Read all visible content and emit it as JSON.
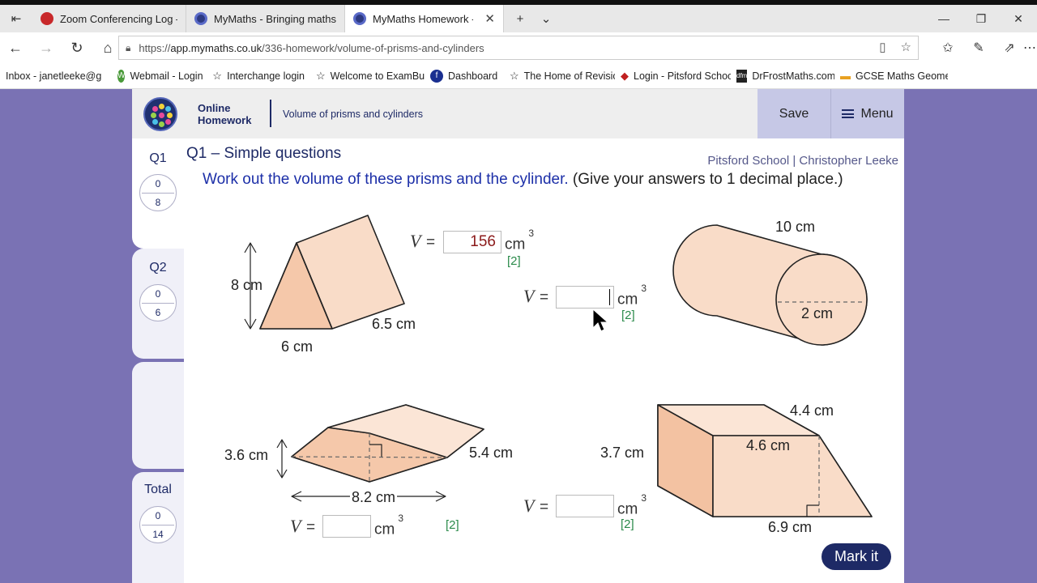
{
  "browser": {
    "tabs": [
      {
        "label": "Zoom Conferencing Log —",
        "favicon": "zoom-icon"
      },
      {
        "label": "MyMaths - Bringing maths a",
        "favicon": "mymaths-icon"
      },
      {
        "label": "MyMaths Homework - V",
        "favicon": "mymaths-icon",
        "active": true
      }
    ],
    "url_prefix": "https://",
    "url_domain": "app.mymaths.co.uk",
    "url_path": "/336-homework/volume-of-prisms-and-cylinders",
    "favorites": [
      {
        "label": "Inbox - janetleeke@g"
      },
      {
        "label": "Webmail - Login"
      },
      {
        "label": "Interchange login"
      },
      {
        "label": "Welcome to ExamBui"
      },
      {
        "label": "Dashboard"
      },
      {
        "label": "The Home of Revisior"
      },
      {
        "label": "Login - Pitsford Schoo"
      },
      {
        "label": "DrFrostMaths.com"
      },
      {
        "label": "GCSE Maths Geometr"
      }
    ]
  },
  "header": {
    "brand_line1": "Online",
    "brand_line2": "Homework",
    "topic": "Volume of prisms and cylinders",
    "save_label": "Save",
    "menu_label": "Menu"
  },
  "sidebar": {
    "items": [
      {
        "label": "Q1",
        "score": "0",
        "max": "8"
      },
      {
        "label": "Q2",
        "score": "0",
        "max": "6"
      },
      {
        "label": "Total",
        "score": "0",
        "max": "14"
      }
    ]
  },
  "question": {
    "title": "Q1 – Simple questions",
    "school": "Pitsford School | Christopher Leeke",
    "instruction_blue": "Work out the volume of these prisms and the cylinder.",
    "instruction_rest": " (Give your answers to 1 decimal place.)",
    "v_label": "V",
    "equals": "=",
    "unit": "cm",
    "unit_power": "3",
    "marks": "[2]",
    "answers": {
      "triangular": "156",
      "cylinder": "",
      "rhombus": "",
      "trapezium": ""
    },
    "dims": {
      "tri_height": "8 cm",
      "tri_base": "6 cm",
      "tri_length": "6.5 cm",
      "cyl_length": "10 cm",
      "cyl_radius": "2 cm",
      "rho_height": "3.6 cm",
      "rho_depth": "5.4 cm",
      "rho_width": "8.2 cm",
      "trap_height": "3.7 cm",
      "trap_top": "4.4 cm",
      "trap_mid": "4.6 cm",
      "trap_base": "6.9 cm"
    },
    "mark_button": "Mark it"
  },
  "colors": {
    "shape_fill": "#f9dcc8",
    "shape_fill_dark": "#f3c2a2",
    "navy": "#1e2a66",
    "purple_bg": "#7a72b4"
  }
}
